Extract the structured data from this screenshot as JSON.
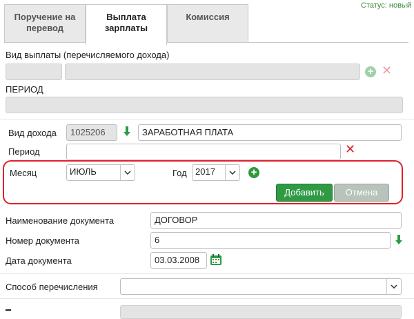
{
  "status": "Статус: новый",
  "tabs": [
    {
      "label_1": "Поручение на",
      "label_2": "перевод"
    },
    {
      "label_1": "Выплата",
      "label_2": "зарплаты"
    },
    {
      "label_1": "Комиссия",
      "label_2": ""
    }
  ],
  "payout_type_label": "Вид выплаты (перечисляемого дохода)",
  "period_header_label": "ПЕРИОД",
  "income": {
    "label": "Вид дохода",
    "code": "1025206",
    "name": "ЗАРАБОТНАЯ ПЛАТА"
  },
  "period": {
    "label": "Период",
    "value": ""
  },
  "month": {
    "label": "Месяц",
    "value": "ИЮЛЬ"
  },
  "year": {
    "label": "Год",
    "value": "2017"
  },
  "buttons": {
    "add": "Добавить",
    "cancel": "Отмена"
  },
  "document_name": {
    "label": "Наименование документа",
    "value": "ДОГОВОР"
  },
  "document_number": {
    "label": "Номер документа",
    "value": "6"
  },
  "document_date": {
    "label": "Дата документа",
    "value": "03.03.2008"
  },
  "transfer_method": {
    "label": "Способ перечисления",
    "value": ""
  },
  "colors": {
    "accent_green": "#2f9a43",
    "red": "#e0202a"
  }
}
